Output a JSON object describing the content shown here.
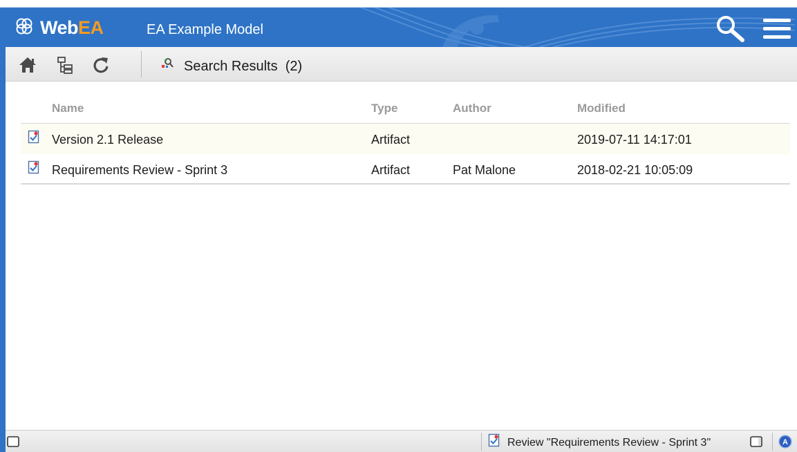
{
  "header": {
    "logo_text_web": "Web",
    "logo_text_ea": "EA",
    "model_name": "EA Example Model",
    "search_icon": "magnifier-icon",
    "menu_icon": "hamburger-menu-icon"
  },
  "toolbar": {
    "home_icon": "home-icon",
    "browser_icon": "tree-browser-icon",
    "refresh_icon": "refresh-icon",
    "search_icon": "search-results-icon",
    "title": "Search Results",
    "count": "(2)"
  },
  "table": {
    "columns": [
      "Name",
      "Type",
      "Author",
      "Modified"
    ],
    "rows": [
      {
        "icon": "artifact-icon",
        "name": "Version 2.1 Release",
        "type": "Artifact",
        "author": "",
        "modified": "2019-07-11 14:17:01",
        "selected": true
      },
      {
        "icon": "artifact-icon",
        "name": "Requirements Review - Sprint 3",
        "type": "Artifact",
        "author": "Pat Malone",
        "modified": "2018-02-21 10:05:09",
        "selected": false
      }
    ]
  },
  "statusbar": {
    "left_icon": "panel-toggle-icon",
    "current_icon": "artifact-icon",
    "current_text": "Review \"Requirements Review - Sprint 3\"",
    "right_panel_icon": "properties-panel-icon",
    "status_icon": "user-status-icon"
  },
  "colors": {
    "header_blue": "#2e73c6",
    "logo_orange": "#f39a22",
    "selected_row": "#fdfcf2",
    "header_text_muted": "#9a9a9a"
  }
}
